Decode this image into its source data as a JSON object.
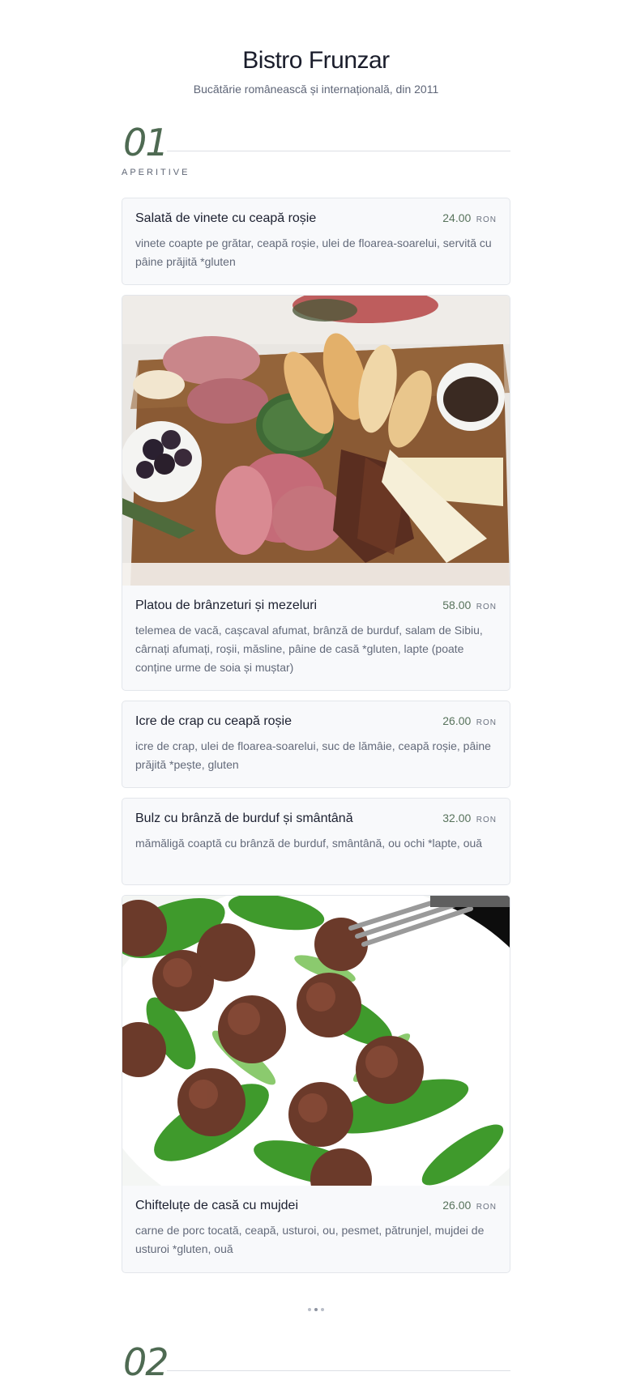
{
  "header": {
    "title": "Bistro Frunzar",
    "subtitle": "Bucătărie românească și internațională, din 2011"
  },
  "sections": [
    {
      "number": "01",
      "name": "APERITIVE",
      "items": [
        {
          "name": "Salată de vinete cu ceapă roșie",
          "price": "24.00",
          "currency": "RON",
          "description": "vinete coapte pe grătar, ceapă roșie, ulei de floarea-soarelui, servită cu pâine prăjită *gluten"
        },
        {
          "name": "Platou de brânzeturi și mezeluri",
          "price": "58.00",
          "currency": "RON",
          "description": "telemea de vacă, cașcaval afumat, brânză de burduf, salam de Sibiu, cârnați afumați, roșii, măsline, pâine de casă *gluten, lapte (poate conține urme de soia și muștar)",
          "photo": "charcuterie-board-photo"
        },
        {
          "name": "Icre de crap cu ceapă roșie",
          "price": "26.00",
          "currency": "RON",
          "description": "icre de crap, ulei de floarea-soarelui, suc de lămâie, ceapă roșie, pâine prăjită *pește, gluten"
        },
        {
          "name": "Bulz cu brânză de burduf și smântână",
          "price": "32.00",
          "currency": "RON",
          "description": "mămăligă coaptă cu brânză de burduf, smântână, ou ochi *lapte, ouă"
        },
        {
          "name": "Chifteluțe de casă cu mujdei",
          "price": "26.00",
          "currency": "RON",
          "description": "carne de porc tocată, ceapă, usturoi, ou, pesmet, pătrunjel, mujdei de usturoi *gluten, ouă",
          "photo": "meatballs-photo"
        }
      ]
    },
    {
      "number": "02",
      "name": ""
    }
  ],
  "colors": {
    "accent": "#4e6a52",
    "card_bg": "#f8f9fb",
    "card_border": "#e3e6eb"
  }
}
